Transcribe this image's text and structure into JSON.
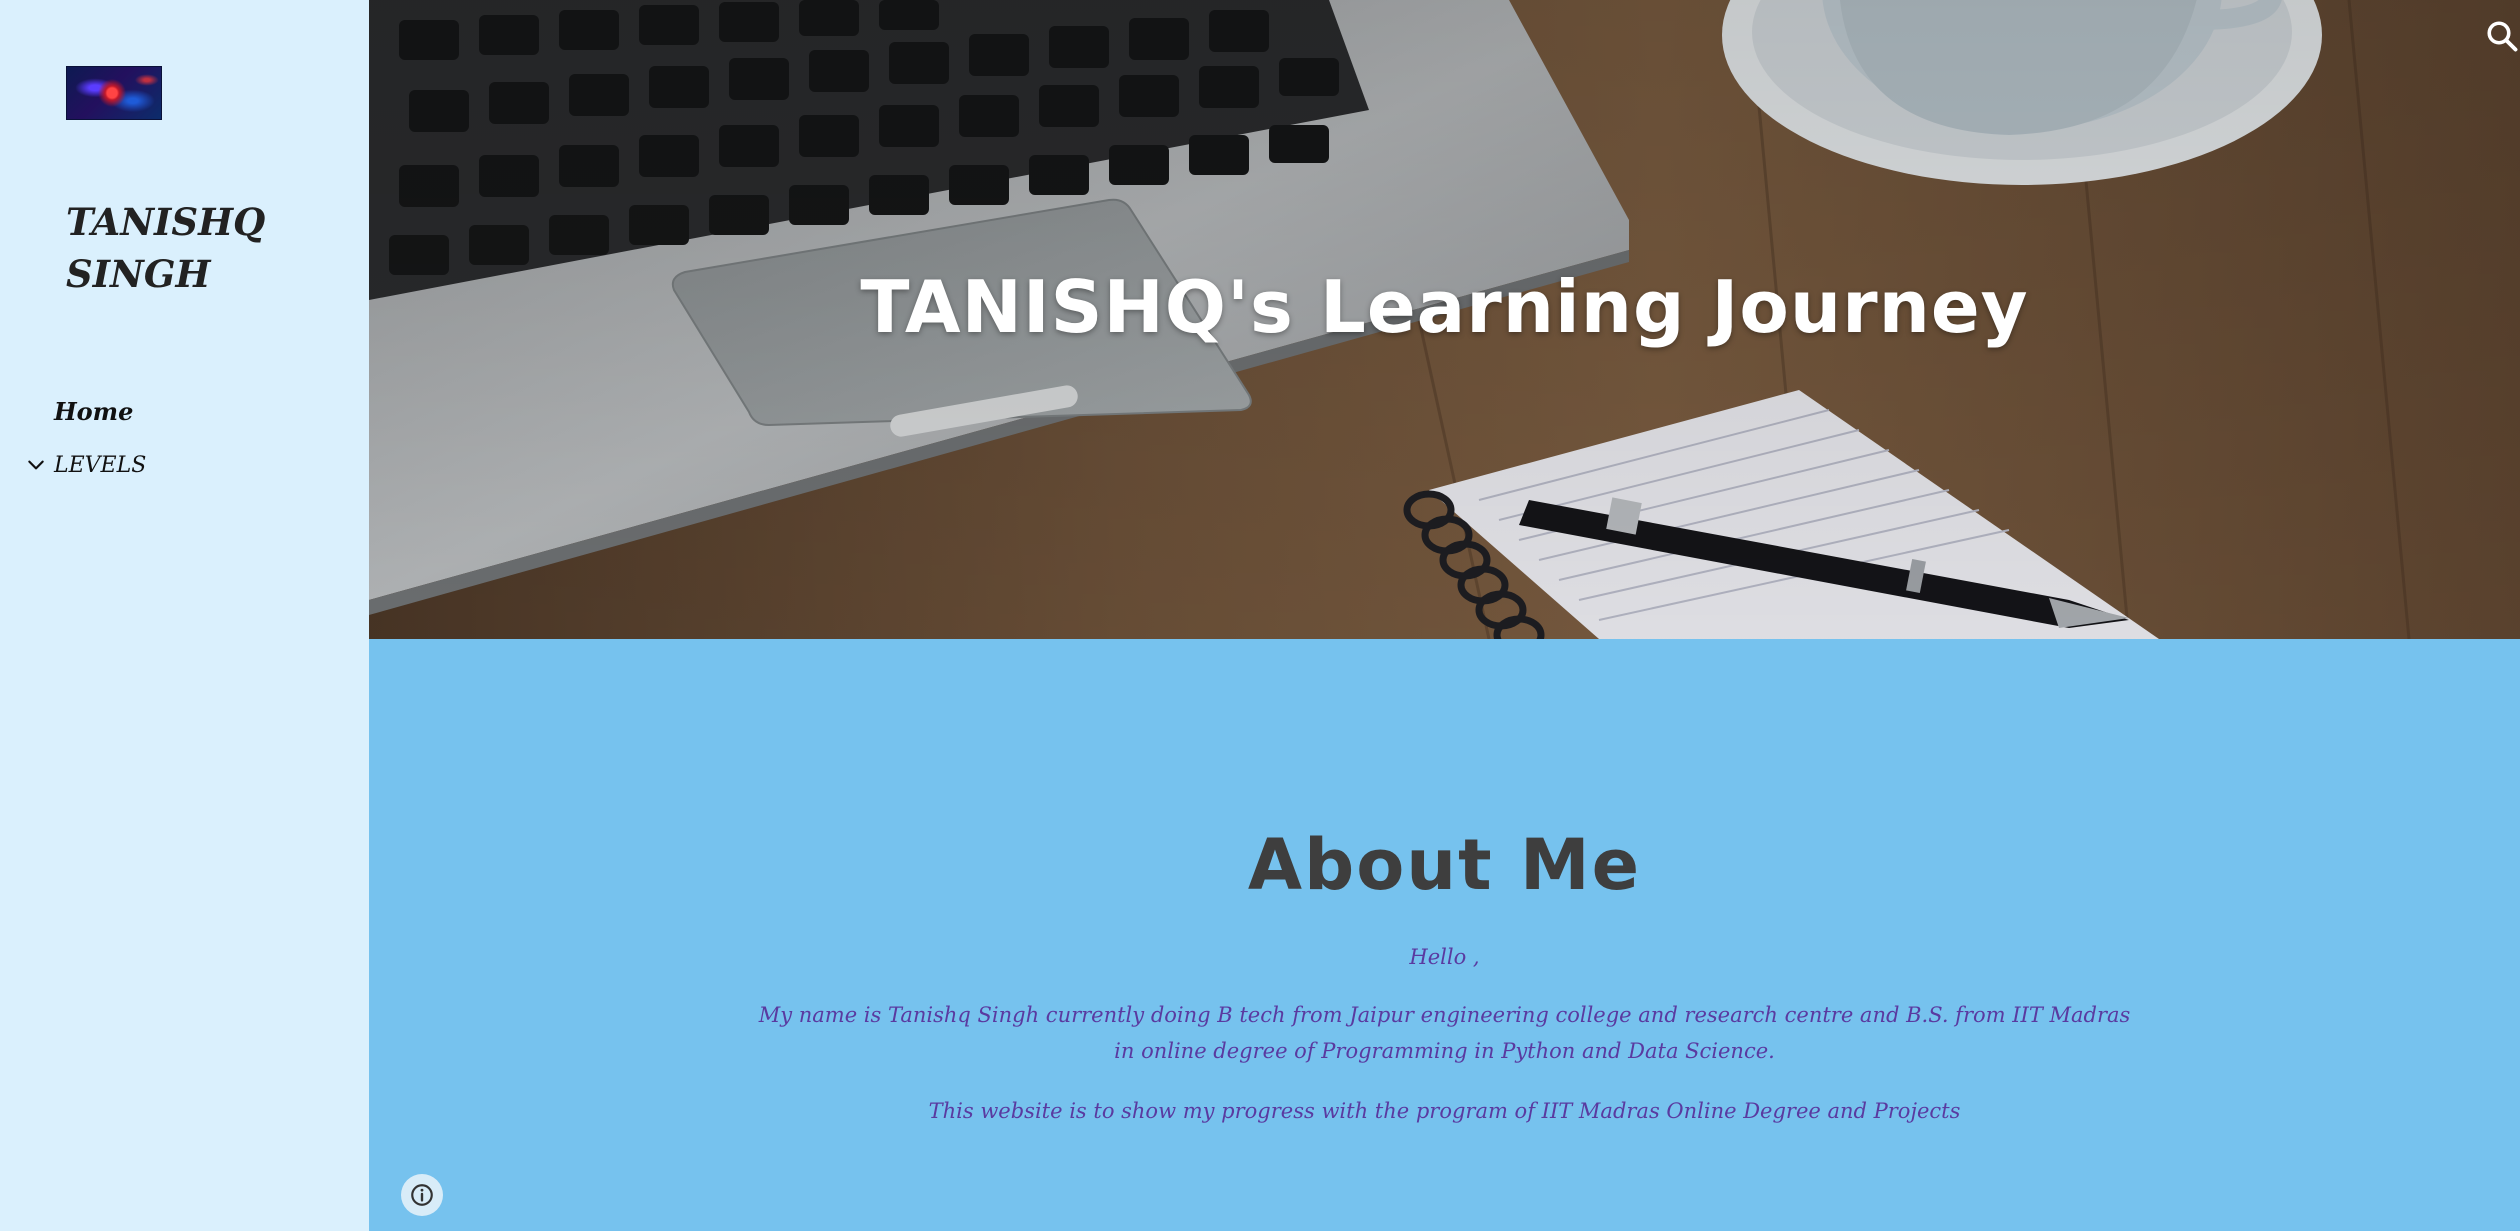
{
  "sidebar": {
    "logo_name": "site-logo",
    "site_name": "TANISHQ SINGH",
    "nav": [
      {
        "label": "Home",
        "icon": ""
      },
      {
        "label": "LEVELS",
        "icon": "chevron-down-icon"
      }
    ]
  },
  "hero": {
    "title": "TANISHQ's Learning Journey",
    "search_icon": "search-icon"
  },
  "about": {
    "title": "About Me",
    "greeting": "Hello ,",
    "paragraph1": "My name is Tanishq Singh currently doing B tech from Jaipur engineering college and research centre and B.S. from IIT Madras in online degree of Programming in Python and Data Science.",
    "paragraph2": "This website is to show my progress with the program of IIT Madras Online Degree and Projects"
  },
  "footer": {
    "info_icon": "info-icon"
  },
  "colors": {
    "sidebar_bg": "#daf0fd",
    "section_bg": "#76c2ee",
    "heading": "#3e3e3e",
    "body_text": "#5a3aa0"
  }
}
